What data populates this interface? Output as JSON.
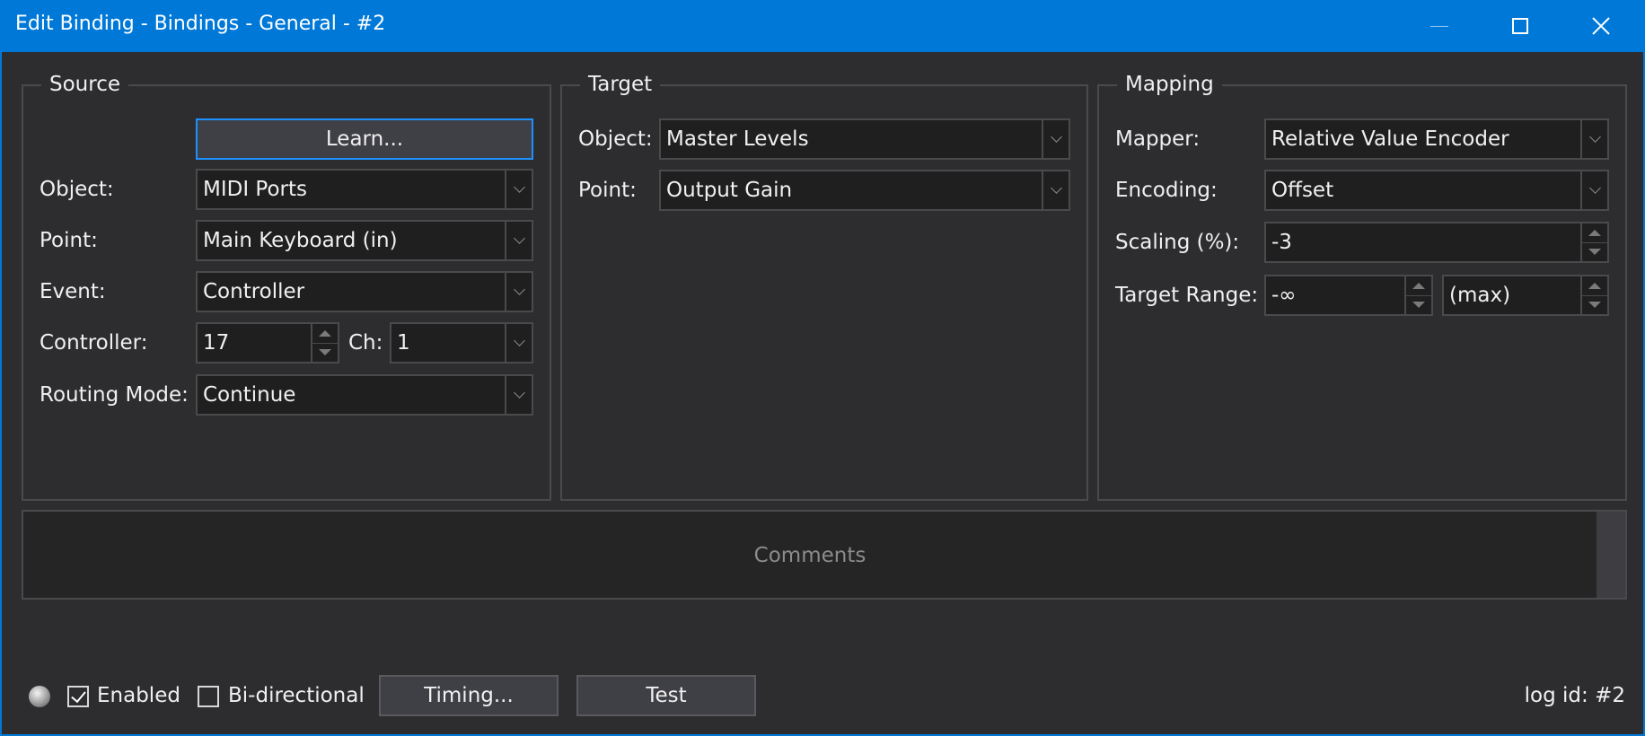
{
  "window": {
    "title": "Edit Binding - Bindings - General - #2",
    "accent": "#0078d7"
  },
  "source": {
    "legend": "Source",
    "learn_label": "Learn...",
    "object_label": "Object:",
    "object_value": "MIDI Ports",
    "point_label": "Point:",
    "point_value": "Main Keyboard (in)",
    "event_label": "Event:",
    "event_value": "Controller",
    "controller_label": "Controller:",
    "controller_value": "17",
    "ch_label": "Ch:",
    "ch_value": "1",
    "routing_label": "Routing Mode:",
    "routing_value": "Continue"
  },
  "target": {
    "legend": "Target",
    "object_label": "Object:",
    "object_value": "Master Levels",
    "point_label": "Point:",
    "point_value": "Output Gain"
  },
  "mapping": {
    "legend": "Mapping",
    "mapper_label": "Mapper:",
    "mapper_value": "Relative Value Encoder",
    "encoding_label": "Encoding:",
    "encoding_value": "Offset",
    "scaling_label": "Scaling (%):",
    "scaling_value": "-3",
    "range_label": "Target Range:",
    "range_min": "-∞",
    "range_max": "(max)"
  },
  "comments": {
    "placeholder": "Comments"
  },
  "footer": {
    "enabled_label": "Enabled",
    "enabled_checked": true,
    "bidirectional_label": "Bi-directional",
    "bidirectional_checked": false,
    "timing_label": "Timing...",
    "test_label": "Test",
    "log_id": "log id: #2"
  }
}
